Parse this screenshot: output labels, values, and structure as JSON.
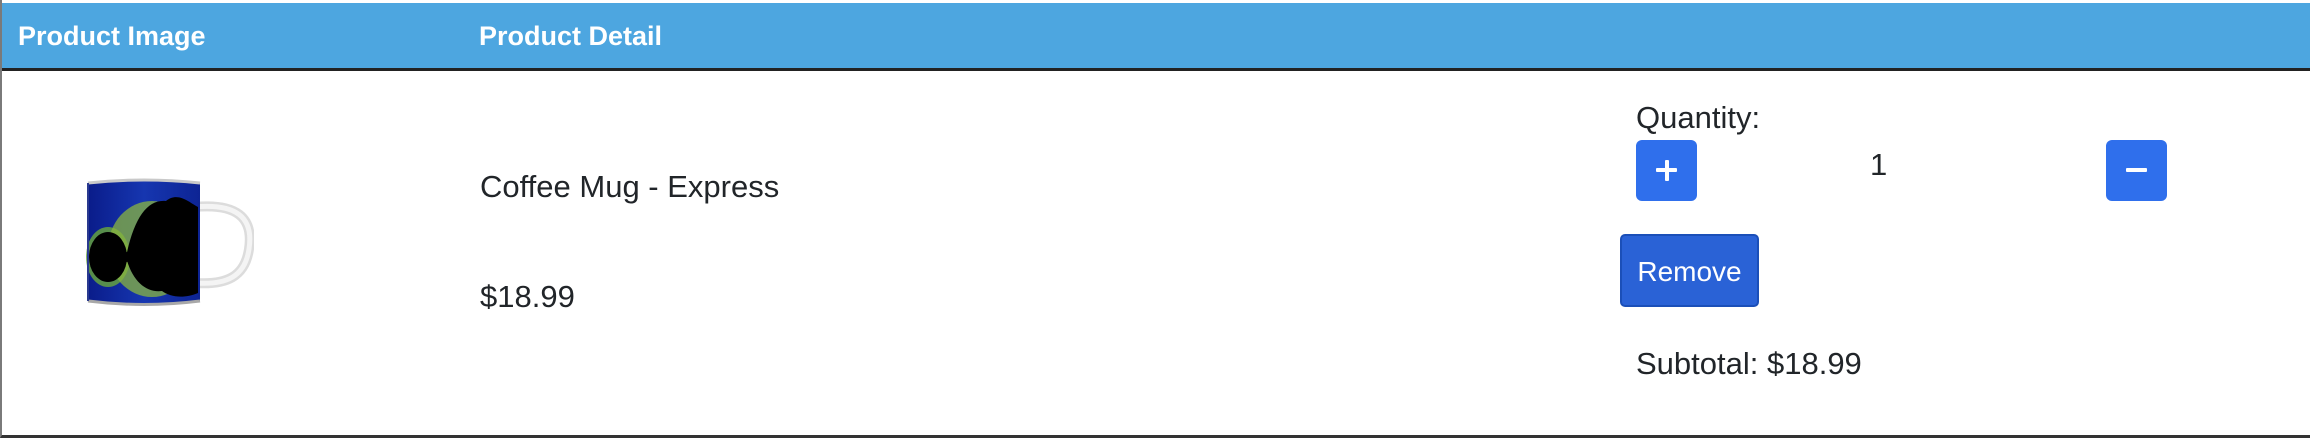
{
  "header": {
    "image_col": "Product Image",
    "detail_col": "Product Detail"
  },
  "item": {
    "image_icon": "coffee-mug-image",
    "name": "Coffee Mug - Express",
    "price": "$18.99",
    "quantity_label": "Quantity:",
    "quantity": "1",
    "increase_icon": "plus-icon",
    "decrease_icon": "minus-icon",
    "remove_label": "Remove",
    "subtotal": "Subtotal: $18.99"
  },
  "colors": {
    "header_bg": "#4da6e0",
    "button_blue": "#2f6fec",
    "remove_blue": "#2a62d6"
  }
}
